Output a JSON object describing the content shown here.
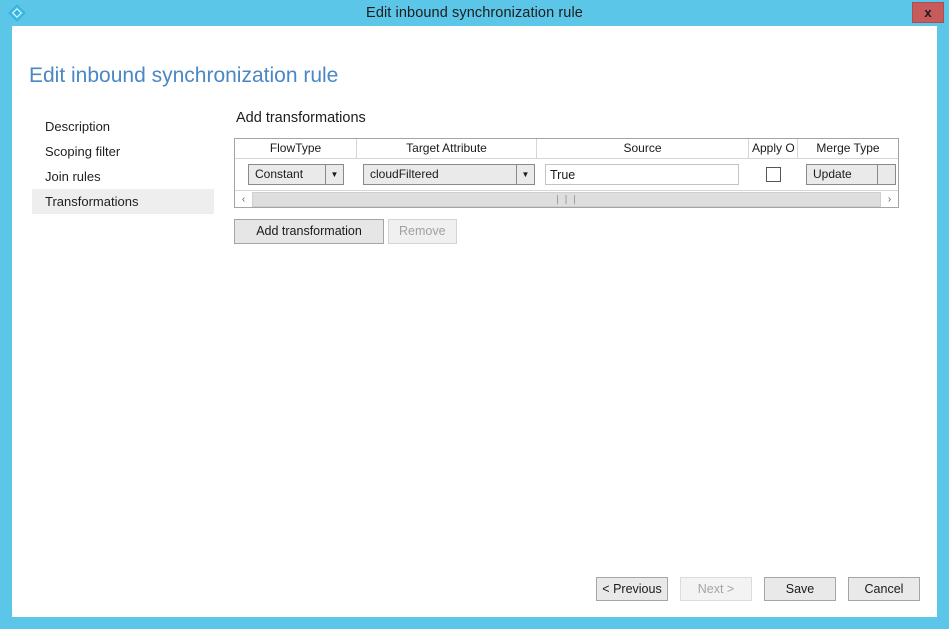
{
  "window": {
    "title": "Edit inbound synchronization rule",
    "icon": "azure-diamond-icon",
    "close_label": "x",
    "titlebar_color": "#5bc6e8",
    "close_button_color": "#c75b5b"
  },
  "page": {
    "heading": "Edit inbound synchronization rule",
    "heading_color": "#4a87c4"
  },
  "sidebar": {
    "items": [
      {
        "label": "Description",
        "selected": false
      },
      {
        "label": "Scoping filter",
        "selected": false
      },
      {
        "label": "Join rules",
        "selected": false
      },
      {
        "label": "Transformations",
        "selected": true
      }
    ]
  },
  "main": {
    "section_title": "Add transformations",
    "grid": {
      "columns": [
        "FlowType",
        "Target Attribute",
        "Source",
        "Apply O",
        "Merge Type"
      ],
      "rows": [
        {
          "flow_type": "Constant",
          "target_attribute": "cloudFiltered",
          "source": "True",
          "apply_once": false,
          "merge_type": "Update"
        }
      ],
      "scrollbar": {
        "left_arrow": "‹",
        "right_arrow": "›",
        "grip": "❘❘❘"
      },
      "dropdown_arrow": "▼"
    },
    "actions": {
      "add_transformation": "Add transformation",
      "remove": "Remove",
      "remove_enabled": false
    }
  },
  "footer": {
    "previous": "< Previous",
    "next": "Next >",
    "next_enabled": false,
    "save": "Save",
    "cancel": "Cancel"
  }
}
